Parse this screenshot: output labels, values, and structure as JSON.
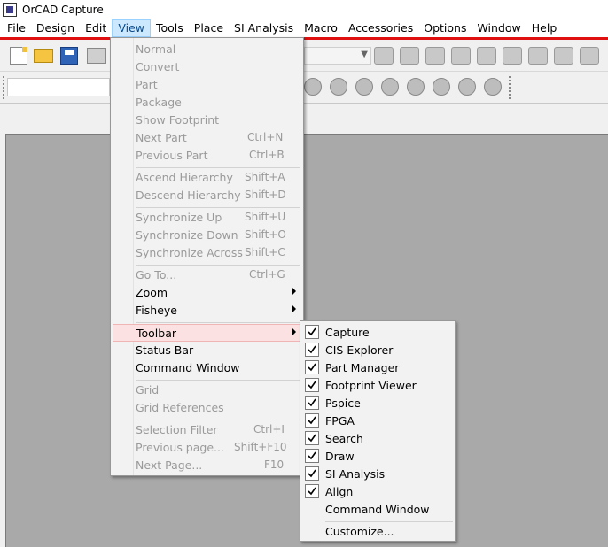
{
  "window": {
    "title": "OrCAD Capture"
  },
  "menubar": {
    "items": [
      "File",
      "Design",
      "Edit",
      "View",
      "Tools",
      "Place",
      "SI Analysis",
      "Macro",
      "Accessories",
      "Options",
      "Window",
      "Help"
    ],
    "active": "View"
  },
  "view_menu": {
    "items": [
      {
        "label": "Normal",
        "shortcut": "",
        "enabled": false
      },
      {
        "label": "Convert",
        "shortcut": "",
        "enabled": false
      },
      {
        "label": "Part",
        "shortcut": "",
        "enabled": false
      },
      {
        "label": "Package",
        "shortcut": "",
        "enabled": false
      },
      {
        "label": "Show Footprint",
        "shortcut": "",
        "enabled": false
      },
      {
        "label": "Next Part",
        "shortcut": "Ctrl+N",
        "enabled": false
      },
      {
        "label": "Previous Part",
        "shortcut": "Ctrl+B",
        "enabled": false
      },
      {
        "label": "Ascend Hierarchy",
        "shortcut": "Shift+A",
        "enabled": false
      },
      {
        "label": "Descend Hierarchy",
        "shortcut": "Shift+D",
        "enabled": false
      },
      {
        "label": "Synchronize Up",
        "shortcut": "Shift+U",
        "enabled": false
      },
      {
        "label": "Synchronize Down",
        "shortcut": "Shift+O",
        "enabled": false
      },
      {
        "label": "Synchronize Across",
        "shortcut": "Shift+C",
        "enabled": false
      },
      {
        "label": "Go To...",
        "shortcut": "Ctrl+G",
        "enabled": false
      },
      {
        "label": "Zoom",
        "shortcut": "",
        "enabled": true,
        "submenu": true
      },
      {
        "label": "Fisheye",
        "shortcut": "",
        "enabled": true,
        "submenu": true
      },
      {
        "label": "Toolbar",
        "shortcut": "",
        "enabled": true,
        "submenu": true,
        "highlighted": true
      },
      {
        "label": "Status Bar",
        "shortcut": "",
        "enabled": true
      },
      {
        "label": "Command Window",
        "shortcut": "",
        "enabled": true
      },
      {
        "label": "Grid",
        "shortcut": "",
        "enabled": false
      },
      {
        "label": "Grid References",
        "shortcut": "",
        "enabled": false
      },
      {
        "label": "Selection Filter",
        "shortcut": "Ctrl+I",
        "enabled": false
      },
      {
        "label": "Previous page...",
        "shortcut": "Shift+F10",
        "enabled": false
      },
      {
        "label": "Next Page...",
        "shortcut": "F10",
        "enabled": false
      }
    ]
  },
  "toolbar_submenu": {
    "items": [
      {
        "label": "Capture",
        "checked": true
      },
      {
        "label": "CIS Explorer",
        "checked": true
      },
      {
        "label": "Part Manager",
        "checked": true
      },
      {
        "label": "Footprint Viewer",
        "checked": true
      },
      {
        "label": "Pspice",
        "checked": true
      },
      {
        "label": "FPGA",
        "checked": true
      },
      {
        "label": "Search",
        "checked": true
      },
      {
        "label": "Draw",
        "checked": true
      },
      {
        "label": "SI Analysis",
        "checked": true
      },
      {
        "label": "Align",
        "checked": true
      },
      {
        "label": "Command Window",
        "checked": false
      },
      {
        "label": "Customize...",
        "checked": false
      }
    ]
  },
  "colors": {
    "accent_line": "#e01010",
    "highlight": "#fbe1e1",
    "workspace": "#a9a9a9"
  }
}
